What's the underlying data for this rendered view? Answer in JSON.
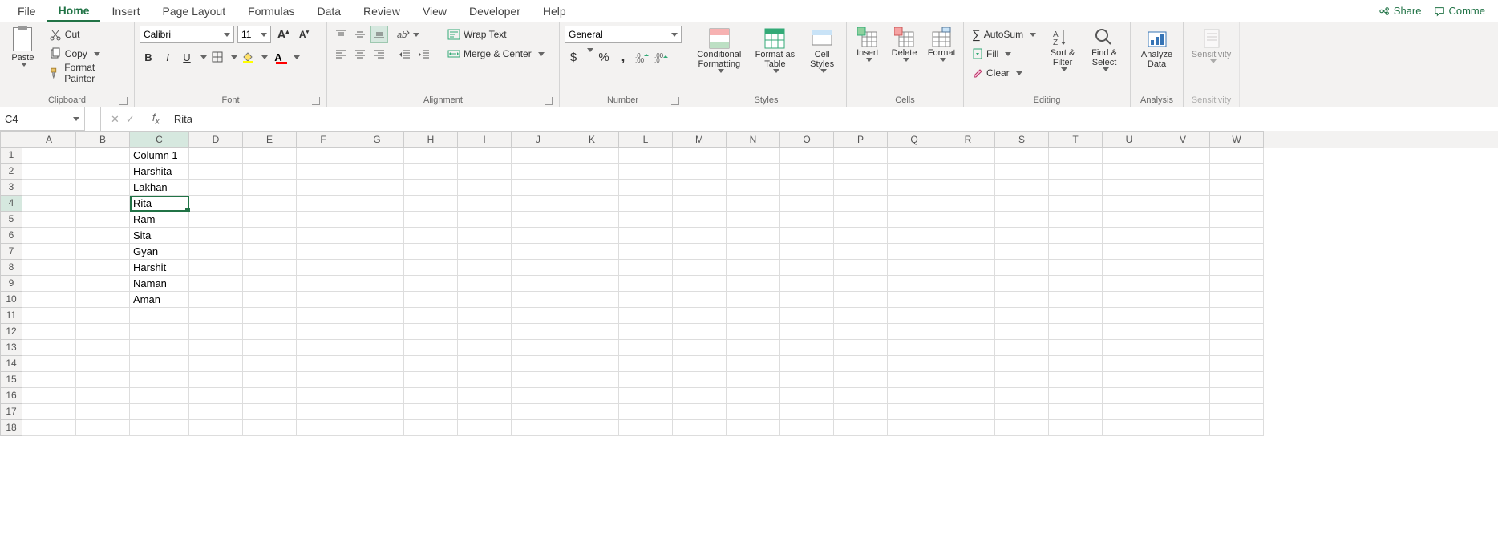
{
  "tabs": {
    "items": [
      "File",
      "Home",
      "Insert",
      "Page Layout",
      "Formulas",
      "Data",
      "Review",
      "View",
      "Developer",
      "Help"
    ],
    "active": "Home",
    "share": "Share",
    "comment": "Comme"
  },
  "ribbon": {
    "clipboard": {
      "label": "Clipboard",
      "paste": "Paste",
      "cut": "Cut",
      "copy": "Copy",
      "format_painter": "Format Painter"
    },
    "font": {
      "label": "Font",
      "name": "Calibri",
      "size": "11"
    },
    "alignment": {
      "label": "Alignment",
      "wrap": "Wrap Text",
      "merge": "Merge & Center"
    },
    "number": {
      "label": "Number",
      "format": "General"
    },
    "styles": {
      "label": "Styles",
      "cond": "Conditional Formatting",
      "table": "Format as Table",
      "cell": "Cell Styles"
    },
    "cells": {
      "label": "Cells",
      "insert": "Insert",
      "delete": "Delete",
      "format": "Format"
    },
    "editing": {
      "label": "Editing",
      "autosum": "AutoSum",
      "fill": "Fill",
      "clear": "Clear",
      "sort": "Sort & Filter",
      "find": "Find & Select"
    },
    "analysis": {
      "label": "Analysis",
      "analyze": "Analyze Data"
    },
    "sensitivity": {
      "label": "Sensitivity",
      "btn": "Sensitivity"
    }
  },
  "formula": {
    "cellref": "C4",
    "value": "Rita"
  },
  "grid": {
    "columns": [
      "A",
      "B",
      "C",
      "D",
      "E",
      "F",
      "G",
      "H",
      "I",
      "J",
      "K",
      "L",
      "M",
      "N",
      "O",
      "P",
      "Q",
      "R",
      "S",
      "T",
      "U",
      "V",
      "W"
    ],
    "rows": 18,
    "selected_col": "C",
    "selected_row": 4,
    "data": {
      "C1": "Column 1",
      "C2": "Harshita",
      "C3": "Lakhan",
      "C4": "Rita",
      "C5": "Ram",
      "C6": "Sita",
      "C7": "Gyan",
      "C8": "Harshit",
      "C9": "Naman",
      "C10": "Aman"
    }
  }
}
